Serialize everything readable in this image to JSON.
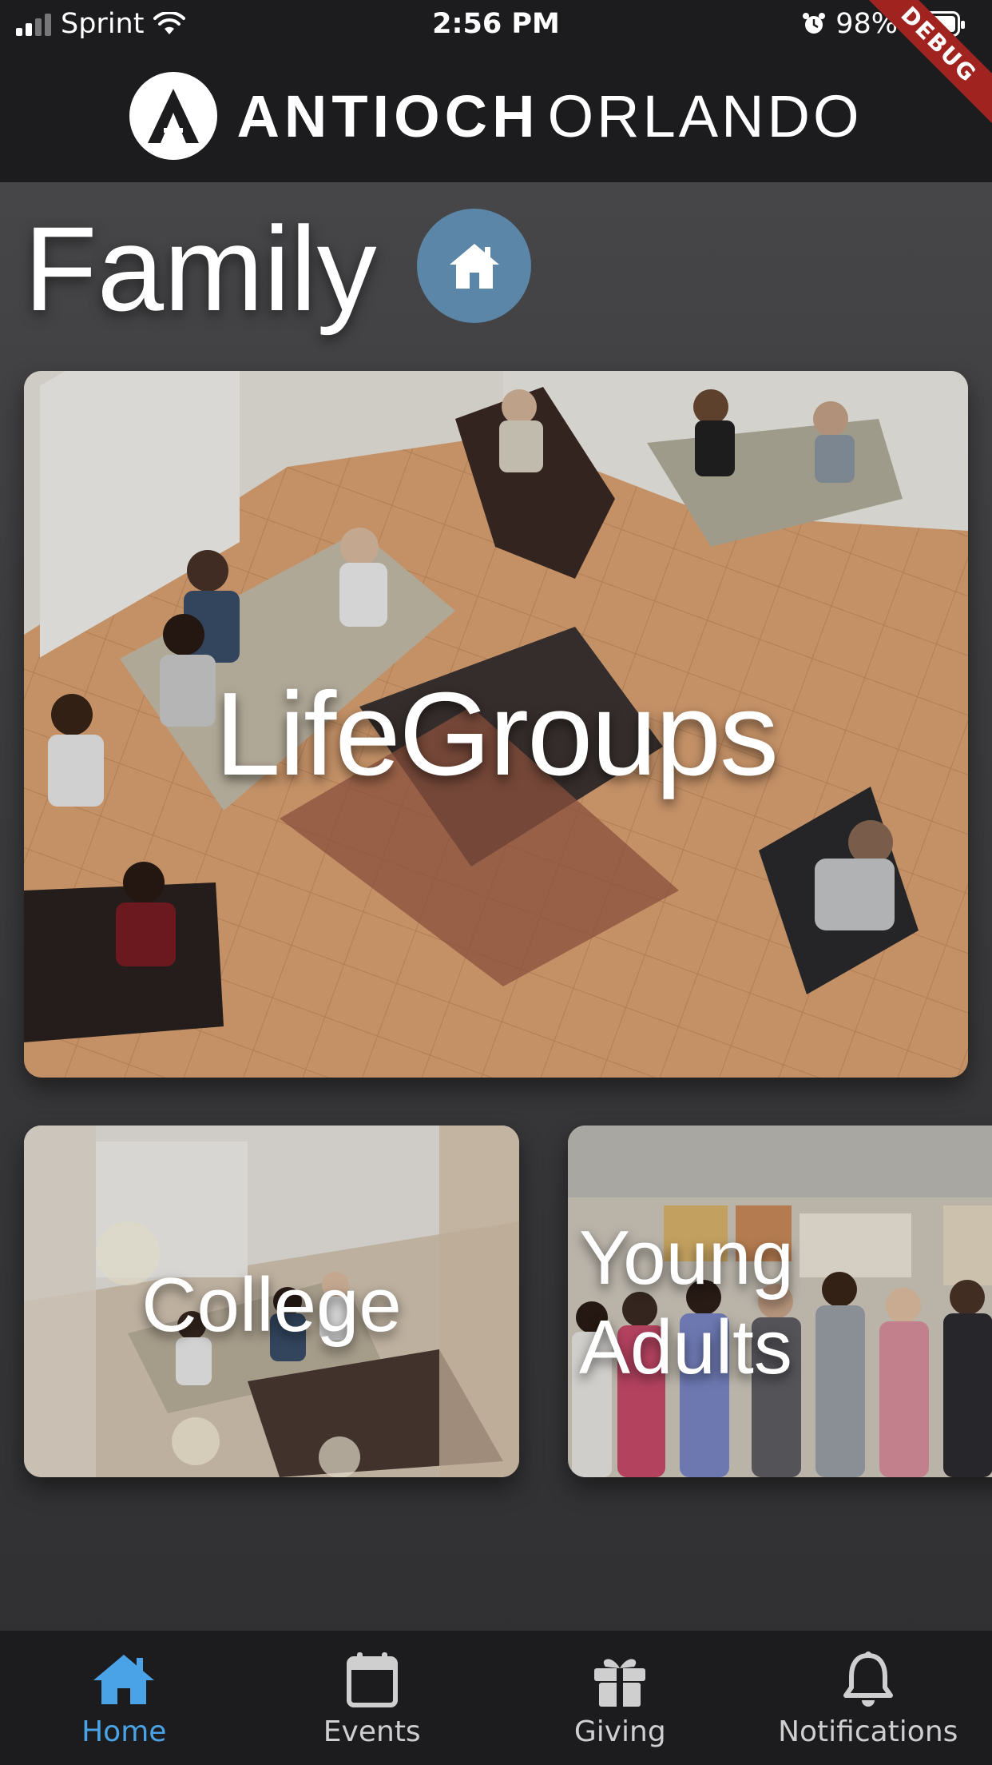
{
  "status_bar": {
    "carrier": "Sprint",
    "time": "2:56 PM",
    "battery": "98%"
  },
  "debug_ribbon": "DEBUG",
  "header": {
    "brand_bold": "ANTIOCH",
    "brand_light": "ORLANDO"
  },
  "page": {
    "title": "Family"
  },
  "cards": {
    "lifegroups": "LifeGroups",
    "college": "College",
    "young_adults_line1": "Young",
    "young_adults_line2": "Adults"
  },
  "nav": {
    "items": [
      {
        "label": "Home",
        "icon": "home-icon",
        "active": true
      },
      {
        "label": "Events",
        "icon": "calendar-icon",
        "active": false
      },
      {
        "label": "Giving",
        "icon": "gift-icon",
        "active": false
      },
      {
        "label": "Notifications",
        "icon": "bell-icon",
        "active": false
      }
    ]
  },
  "colors": {
    "accent": "#4aa3e6",
    "home_badge": "#5b86a8",
    "bar_background": "#1c1c1e",
    "debug": "#a0231f"
  }
}
